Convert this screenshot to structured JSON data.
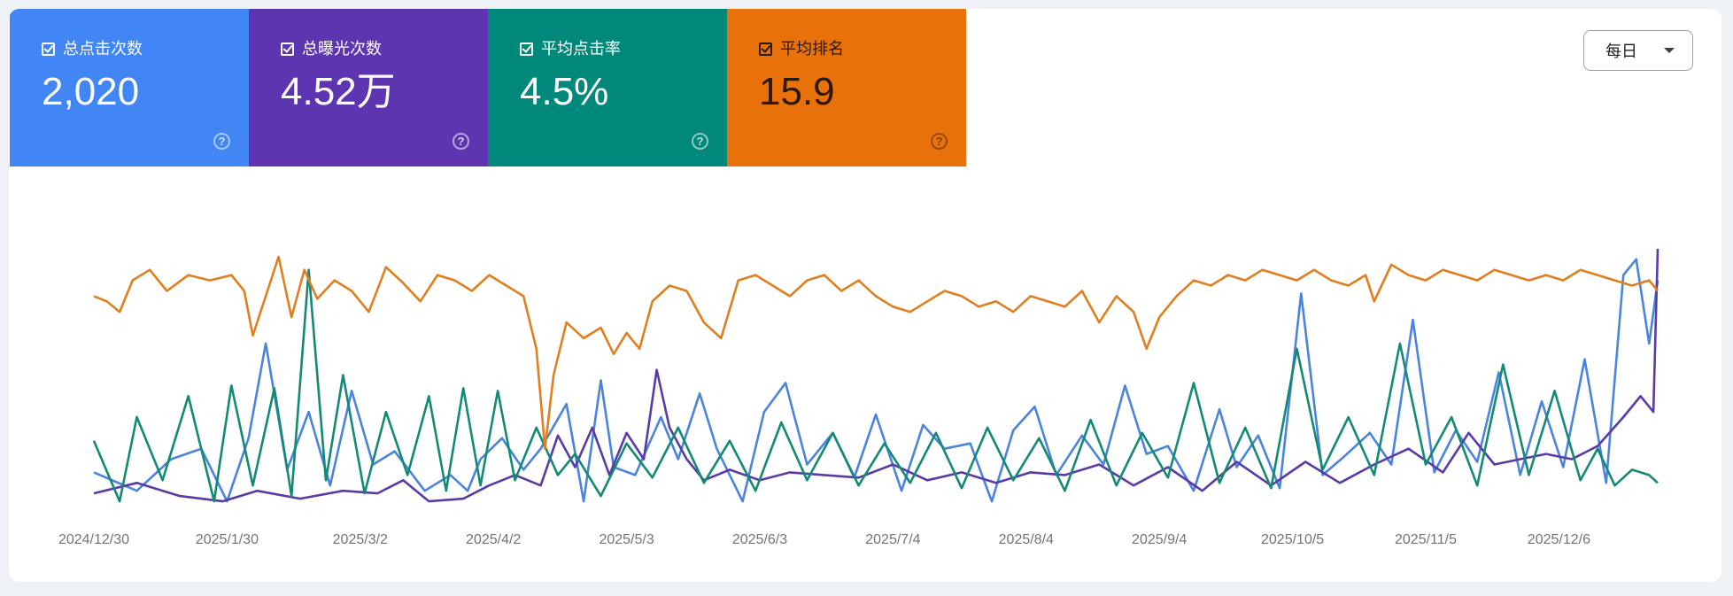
{
  "metrics": [
    {
      "label": "总点击次数",
      "value": "2,020",
      "bg": "#4285f4",
      "text": "#ffffff",
      "line": "#4a84dc"
    },
    {
      "label": "总曝光次数",
      "value": "4.52万",
      "bg": "#5e35b1",
      "text": "#ffffff",
      "line": "#5a3aa6"
    },
    {
      "label": "平均点击率",
      "value": "4.5%",
      "bg": "#00897b",
      "text": "#ffffff",
      "line": "#138a73"
    },
    {
      "label": "平均排名",
      "value": "15.9",
      "bg": "#e8710a",
      "text": "#2b1a0a",
      "line": "#e07f1f"
    }
  ],
  "period_select": {
    "value": "每日"
  },
  "chart_data": {
    "type": "line",
    "x_start": "2024/12/30",
    "x_end": "2025/12/29",
    "x_tick_labels": [
      "2024/12/30",
      "2025/1/30",
      "2025/3/2",
      "2025/4/2",
      "2025/5/3",
      "2025/6/3",
      "2025/7/4",
      "2025/8/4",
      "2025/9/4",
      "2025/10/5",
      "2025/11/5",
      "2025/12/6"
    ],
    "normalized_per_series": true,
    "grid": false,
    "series": [
      {
        "name": "总点击次数",
        "color": "#4a84dc",
        "points": [
          [
            0,
            0.13
          ],
          [
            10,
            0.06
          ],
          [
            18,
            0.18
          ],
          [
            25,
            0.22
          ],
          [
            31,
            0.02
          ],
          [
            36,
            0.26
          ],
          [
            40,
            0.62
          ],
          [
            45,
            0.14
          ],
          [
            50,
            0.36
          ],
          [
            55,
            0.08
          ],
          [
            60,
            0.44
          ],
          [
            65,
            0.16
          ],
          [
            70,
            0.21
          ],
          [
            77,
            0.06
          ],
          [
            83,
            0.12
          ],
          [
            87,
            0.06
          ],
          [
            90,
            0.18
          ],
          [
            95,
            0.26
          ],
          [
            100,
            0.14
          ],
          [
            104,
            0.22
          ],
          [
            110,
            0.39
          ],
          [
            114,
            0.02
          ],
          [
            118,
            0.48
          ],
          [
            121,
            0.15
          ],
          [
            126,
            0.12
          ],
          [
            132,
            0.34
          ],
          [
            136,
            0.18
          ],
          [
            141,
            0.43
          ],
          [
            145,
            0.22
          ],
          [
            151,
            0.02
          ],
          [
            156,
            0.36
          ],
          [
            161,
            0.47
          ],
          [
            166,
            0.16
          ],
          [
            172,
            0.28
          ],
          [
            177,
            0.11
          ],
          [
            182,
            0.35
          ],
          [
            188,
            0.06
          ],
          [
            193,
            0.31
          ],
          [
            198,
            0.22
          ],
          [
            204,
            0.24
          ],
          [
            209,
            0.02
          ],
          [
            214,
            0.29
          ],
          [
            219,
            0.38
          ],
          [
            224,
            0.12
          ],
          [
            230,
            0.27
          ],
          [
            235,
            0.16
          ],
          [
            240,
            0.46
          ],
          [
            245,
            0.2
          ],
          [
            250,
            0.23
          ],
          [
            256,
            0.06
          ],
          [
            262,
            0.37
          ],
          [
            266,
            0.15
          ],
          [
            271,
            0.27
          ],
          [
            276,
            0.07
          ],
          [
            281,
            0.81
          ],
          [
            286,
            0.12
          ],
          [
            291,
            0.19
          ],
          [
            297,
            0.28
          ],
          [
            302,
            0.16
          ],
          [
            307,
            0.71
          ],
          [
            312,
            0.13
          ],
          [
            317,
            0.29
          ],
          [
            322,
            0.17
          ],
          [
            327,
            0.51
          ],
          [
            332,
            0.12
          ],
          [
            337,
            0.4
          ],
          [
            342,
            0.15
          ],
          [
            347,
            0.56
          ],
          [
            352,
            0.09
          ],
          [
            356,
            0.88
          ],
          [
            359,
            0.94
          ],
          [
            362,
            0.62
          ],
          [
            364,
            0.86
          ]
        ]
      },
      {
        "name": "总曝光次数",
        "color": "#5a3aa6",
        "points": [
          [
            0,
            0.05
          ],
          [
            10,
            0.09
          ],
          [
            20,
            0.04
          ],
          [
            30,
            0.02
          ],
          [
            38,
            0.06
          ],
          [
            48,
            0.03
          ],
          [
            58,
            0.06
          ],
          [
            66,
            0.05
          ],
          [
            72,
            0.1
          ],
          [
            78,
            0.02
          ],
          [
            86,
            0.03
          ],
          [
            92,
            0.08
          ],
          [
            98,
            0.12
          ],
          [
            104,
            0.08
          ],
          [
            108,
            0.27
          ],
          [
            112,
            0.15
          ],
          [
            116,
            0.3
          ],
          [
            120,
            0.12
          ],
          [
            124,
            0.28
          ],
          [
            128,
            0.18
          ],
          [
            131,
            0.52
          ],
          [
            134,
            0.3
          ],
          [
            138,
            0.18
          ],
          [
            142,
            0.1
          ],
          [
            148,
            0.14
          ],
          [
            155,
            0.1
          ],
          [
            162,
            0.13
          ],
          [
            170,
            0.12
          ],
          [
            178,
            0.11
          ],
          [
            186,
            0.16
          ],
          [
            194,
            0.1
          ],
          [
            202,
            0.13
          ],
          [
            210,
            0.09
          ],
          [
            218,
            0.13
          ],
          [
            226,
            0.12
          ],
          [
            234,
            0.16
          ],
          [
            242,
            0.08
          ],
          [
            250,
            0.15
          ],
          [
            258,
            0.06
          ],
          [
            266,
            0.17
          ],
          [
            274,
            0.08
          ],
          [
            282,
            0.17
          ],
          [
            290,
            0.09
          ],
          [
            298,
            0.16
          ],
          [
            306,
            0.22
          ],
          [
            314,
            0.13
          ],
          [
            320,
            0.28
          ],
          [
            326,
            0.16
          ],
          [
            332,
            0.18
          ],
          [
            338,
            0.2
          ],
          [
            344,
            0.18
          ],
          [
            350,
            0.23
          ],
          [
            356,
            0.34
          ],
          [
            360,
            0.42
          ],
          [
            363,
            0.36
          ],
          [
            364,
            0.98
          ]
        ]
      },
      {
        "name": "平均点击率",
        "color": "#138a73",
        "points": [
          [
            0,
            0.25
          ],
          [
            6,
            0.02
          ],
          [
            10,
            0.34
          ],
          [
            16,
            0.1
          ],
          [
            22,
            0.42
          ],
          [
            28,
            0.02
          ],
          [
            32,
            0.46
          ],
          [
            37,
            0.08
          ],
          [
            42,
            0.45
          ],
          [
            46,
            0.04
          ],
          [
            50,
            0.9
          ],
          [
            54,
            0.1
          ],
          [
            58,
            0.5
          ],
          [
            63,
            0.05
          ],
          [
            68,
            0.36
          ],
          [
            73,
            0.12
          ],
          [
            78,
            0.42
          ],
          [
            82,
            0.06
          ],
          [
            86,
            0.45
          ],
          [
            90,
            0.08
          ],
          [
            94,
            0.44
          ],
          [
            98,
            0.1
          ],
          [
            103,
            0.3
          ],
          [
            108,
            0.12
          ],
          [
            112,
            0.2
          ],
          [
            118,
            0.04
          ],
          [
            124,
            0.24
          ],
          [
            130,
            0.11
          ],
          [
            136,
            0.3
          ],
          [
            142,
            0.09
          ],
          [
            148,
            0.25
          ],
          [
            154,
            0.06
          ],
          [
            160,
            0.32
          ],
          [
            166,
            0.1
          ],
          [
            172,
            0.28
          ],
          [
            178,
            0.08
          ],
          [
            184,
            0.24
          ],
          [
            190,
            0.09
          ],
          [
            196,
            0.28
          ],
          [
            202,
            0.07
          ],
          [
            208,
            0.3
          ],
          [
            214,
            0.1
          ],
          [
            220,
            0.26
          ],
          [
            226,
            0.06
          ],
          [
            232,
            0.33
          ],
          [
            238,
            0.08
          ],
          [
            244,
            0.28
          ],
          [
            250,
            0.11
          ],
          [
            256,
            0.47
          ],
          [
            262,
            0.09
          ],
          [
            268,
            0.3
          ],
          [
            274,
            0.07
          ],
          [
            280,
            0.6
          ],
          [
            286,
            0.14
          ],
          [
            292,
            0.34
          ],
          [
            298,
            0.12
          ],
          [
            304,
            0.62
          ],
          [
            310,
            0.16
          ],
          [
            316,
            0.34
          ],
          [
            322,
            0.08
          ],
          [
            328,
            0.54
          ],
          [
            334,
            0.12
          ],
          [
            340,
            0.44
          ],
          [
            346,
            0.1
          ],
          [
            350,
            0.22
          ],
          [
            354,
            0.08
          ],
          [
            358,
            0.14
          ],
          [
            362,
            0.12
          ],
          [
            364,
            0.09
          ]
        ]
      },
      {
        "name": "平均排名",
        "color": "#e07f1f",
        "points": [
          [
            0,
            0.8
          ],
          [
            3,
            0.78
          ],
          [
            6,
            0.74
          ],
          [
            9,
            0.86
          ],
          [
            13,
            0.9
          ],
          [
            17,
            0.82
          ],
          [
            22,
            0.88
          ],
          [
            27,
            0.86
          ],
          [
            32,
            0.88
          ],
          [
            35,
            0.82
          ],
          [
            37,
            0.65
          ],
          [
            40,
            0.8
          ],
          [
            43,
            0.95
          ],
          [
            46,
            0.72
          ],
          [
            49,
            0.9
          ],
          [
            52,
            0.79
          ],
          [
            56,
            0.86
          ],
          [
            60,
            0.82
          ],
          [
            64,
            0.74
          ],
          [
            68,
            0.91
          ],
          [
            72,
            0.85
          ],
          [
            76,
            0.78
          ],
          [
            80,
            0.88
          ],
          [
            84,
            0.86
          ],
          [
            88,
            0.82
          ],
          [
            92,
            0.88
          ],
          [
            96,
            0.84
          ],
          [
            100,
            0.8
          ],
          [
            103,
            0.6
          ],
          [
            105,
            0.22
          ],
          [
            107,
            0.5
          ],
          [
            110,
            0.7
          ],
          [
            114,
            0.64
          ],
          [
            118,
            0.68
          ],
          [
            121,
            0.58
          ],
          [
            124,
            0.66
          ],
          [
            127,
            0.6
          ],
          [
            130,
            0.78
          ],
          [
            134,
            0.84
          ],
          [
            138,
            0.82
          ],
          [
            142,
            0.7
          ],
          [
            146,
            0.64
          ],
          [
            150,
            0.86
          ],
          [
            154,
            0.88
          ],
          [
            158,
            0.84
          ],
          [
            162,
            0.8
          ],
          [
            166,
            0.86
          ],
          [
            170,
            0.88
          ],
          [
            174,
            0.82
          ],
          [
            178,
            0.86
          ],
          [
            182,
            0.8
          ],
          [
            186,
            0.76
          ],
          [
            190,
            0.74
          ],
          [
            194,
            0.78
          ],
          [
            198,
            0.82
          ],
          [
            202,
            0.8
          ],
          [
            206,
            0.76
          ],
          [
            210,
            0.78
          ],
          [
            214,
            0.74
          ],
          [
            218,
            0.8
          ],
          [
            222,
            0.78
          ],
          [
            226,
            0.76
          ],
          [
            230,
            0.82
          ],
          [
            234,
            0.7
          ],
          [
            238,
            0.8
          ],
          [
            242,
            0.74
          ],
          [
            245,
            0.6
          ],
          [
            248,
            0.72
          ],
          [
            252,
            0.8
          ],
          [
            256,
            0.86
          ],
          [
            260,
            0.84
          ],
          [
            264,
            0.88
          ],
          [
            268,
            0.86
          ],
          [
            272,
            0.9
          ],
          [
            276,
            0.88
          ],
          [
            280,
            0.86
          ],
          [
            284,
            0.9
          ],
          [
            288,
            0.86
          ],
          [
            292,
            0.84
          ],
          [
            296,
            0.88
          ],
          [
            298,
            0.78
          ],
          [
            302,
            0.92
          ],
          [
            306,
            0.88
          ],
          [
            310,
            0.86
          ],
          [
            314,
            0.9
          ],
          [
            318,
            0.88
          ],
          [
            322,
            0.86
          ],
          [
            326,
            0.9
          ],
          [
            330,
            0.88
          ],
          [
            334,
            0.86
          ],
          [
            338,
            0.88
          ],
          [
            342,
            0.86
          ],
          [
            346,
            0.9
          ],
          [
            350,
            0.88
          ],
          [
            354,
            0.86
          ],
          [
            358,
            0.84
          ],
          [
            362,
            0.86
          ],
          [
            364,
            0.82
          ]
        ]
      }
    ]
  }
}
